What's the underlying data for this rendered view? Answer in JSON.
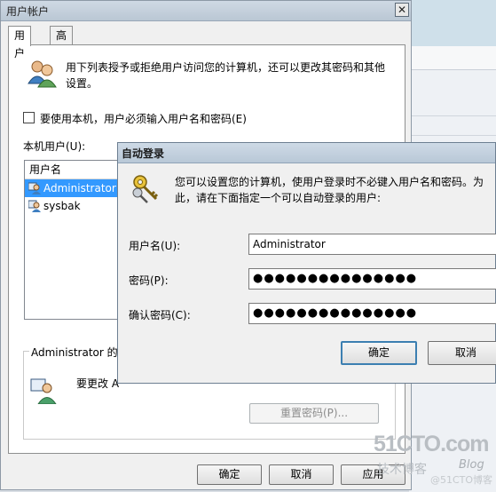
{
  "main_dialog": {
    "title": "用户帐户",
    "close_glyph": "✕",
    "tabs": [
      {
        "label": "用户",
        "active": true
      },
      {
        "label": "高级",
        "active": false
      }
    ],
    "intro_text": "用下列表授予或拒绝用户访问您的计算机，还可以更改其密码和其他设置。",
    "require_login_checkbox": {
      "label": "要使用本机，用户必须输入用户名和密码(E)",
      "checked": false
    },
    "local_users_label": "本机用户(U):",
    "user_list": {
      "column_header": "用户名",
      "items": [
        {
          "name": "Administrator",
          "selected": true
        },
        {
          "name": "sysbak",
          "selected": false
        }
      ]
    },
    "account_group_title": "Administrator 的密",
    "change_password_text": "要更改 A",
    "reset_password_button": "重置密码(P)...",
    "buttons": {
      "ok": "确定",
      "cancel": "取消",
      "apply": "应用"
    }
  },
  "auto_login_dialog": {
    "title": "自动登录",
    "description": "您可以设置您的计算机，使用户登录时不必键入用户名和密码。为此，请在下面指定一个可以自动登录的用户:",
    "fields": [
      {
        "label": "用户名(U):",
        "value": "Administrator"
      },
      {
        "label": "密码(P):",
        "value": "●●●●●●●●●●●●●●●"
      },
      {
        "label": "确认密码(C):",
        "value": "●●●●●●●●●●●●●●●"
      }
    ],
    "buttons": {
      "ok": "确定",
      "cancel": "取消"
    }
  },
  "watermark": {
    "site": "51CTO.com",
    "tagline": "技术博客",
    "blog": "Blog",
    "extra": "@51CTO博客"
  },
  "colors": {
    "selection": "#3399ff",
    "title_bar": "#c4d0dc",
    "default_button_border": "#3c7fb1"
  }
}
